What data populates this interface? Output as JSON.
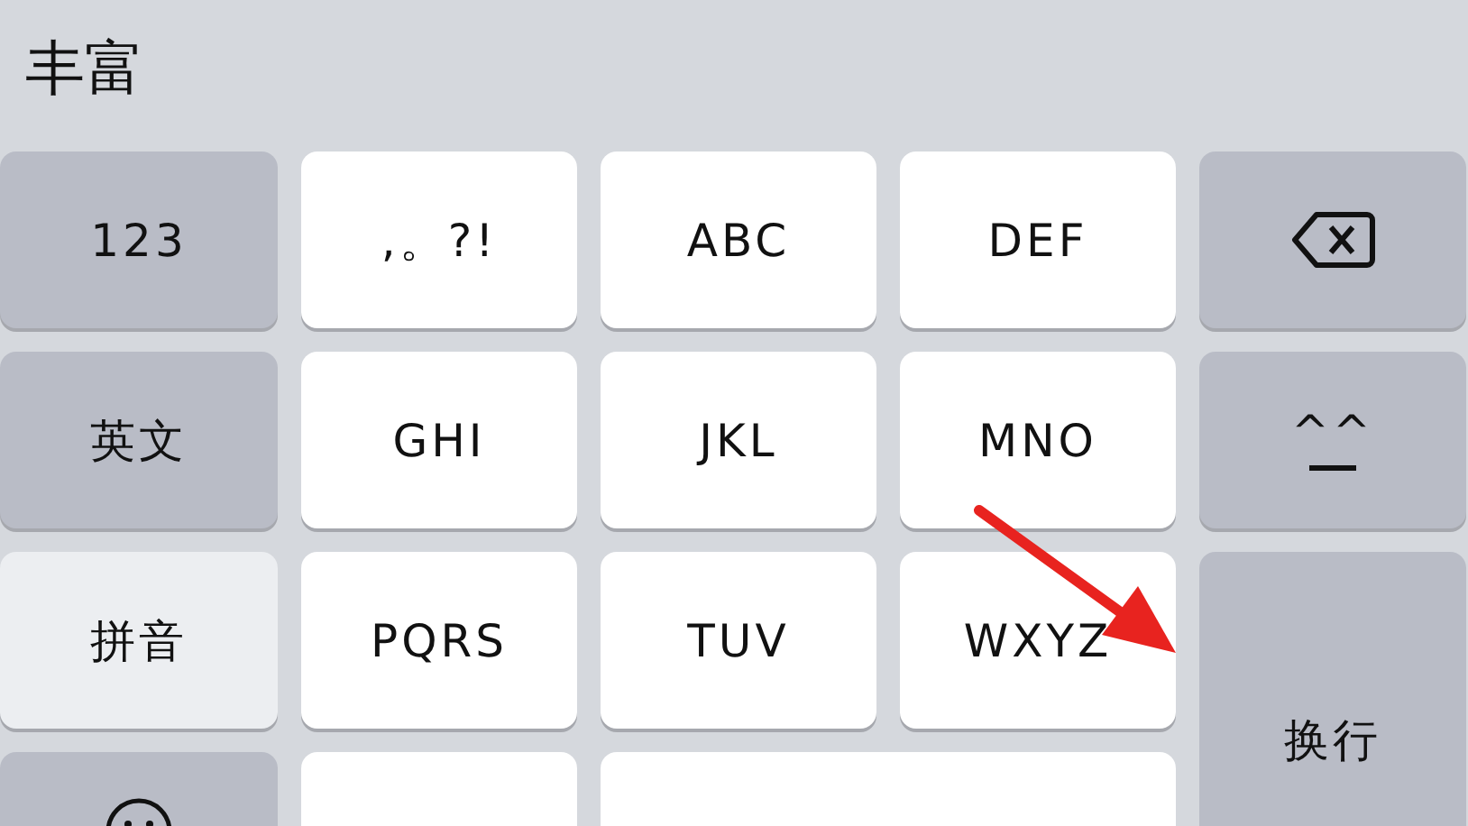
{
  "candidate_bar": {
    "candidates": [
      "丰富"
    ]
  },
  "keys": [
    {
      "kind": "mode",
      "label": "123",
      "selected": false
    },
    {
      "kind": "letter",
      "label": ",。?!"
    },
    {
      "kind": "letter",
      "label": "ABC"
    },
    {
      "kind": "letter",
      "label": "DEF"
    },
    {
      "kind": "delete"
    },
    {
      "kind": "mode",
      "label": "英文",
      "selected": false
    },
    {
      "kind": "letter",
      "label": "GHI"
    },
    {
      "kind": "letter",
      "label": "JKL"
    },
    {
      "kind": "letter",
      "label": "MNO"
    },
    {
      "kind": "kaomoji",
      "label": "^^"
    },
    {
      "kind": "mode",
      "label": "拼音",
      "selected": true
    },
    {
      "kind": "letter",
      "label": "PQRS"
    },
    {
      "kind": "letter",
      "label": "TUV"
    },
    {
      "kind": "letter",
      "label": "WXYZ"
    },
    {
      "kind": "return",
      "label": "换行"
    },
    {
      "kind": "emoji"
    },
    {
      "kind": "letter"
    },
    {
      "kind": "space"
    }
  ],
  "annotation": {
    "kind": "arrow"
  }
}
